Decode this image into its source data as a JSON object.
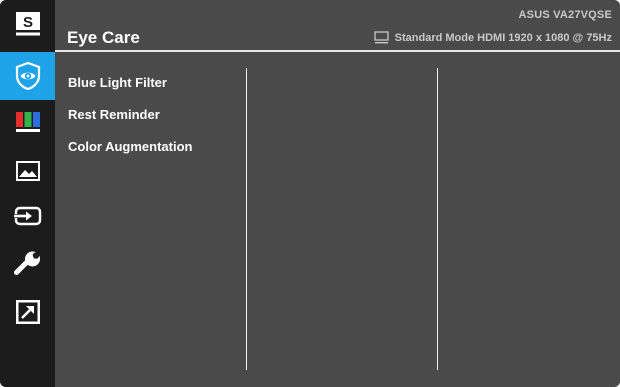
{
  "header": {
    "title": "Eye Care",
    "model": "ASUS  VA27VQSE",
    "status": "Standard Mode HDMI 1920 x 1080 @ 75Hz"
  },
  "sidebar": {
    "items": [
      {
        "icon": "splendid-icon",
        "label": "S",
        "active": false
      },
      {
        "icon": "eye-care-icon",
        "active": true
      },
      {
        "icon": "color-bars-icon",
        "active": false
      },
      {
        "icon": "image-icon",
        "active": false
      },
      {
        "icon": "input-select-icon",
        "active": false
      },
      {
        "icon": "wrench-icon",
        "active": false
      },
      {
        "icon": "shortcut-arrow-icon",
        "active": false
      }
    ]
  },
  "menu": {
    "items": [
      "Blue Light Filter",
      "Rest Reminder",
      "Color Augmentation"
    ]
  },
  "colors": {
    "active_accent": "#1ea3e8",
    "sidebar_bg": "#1c1c1c",
    "panel_bg": "#4a4a4a"
  }
}
